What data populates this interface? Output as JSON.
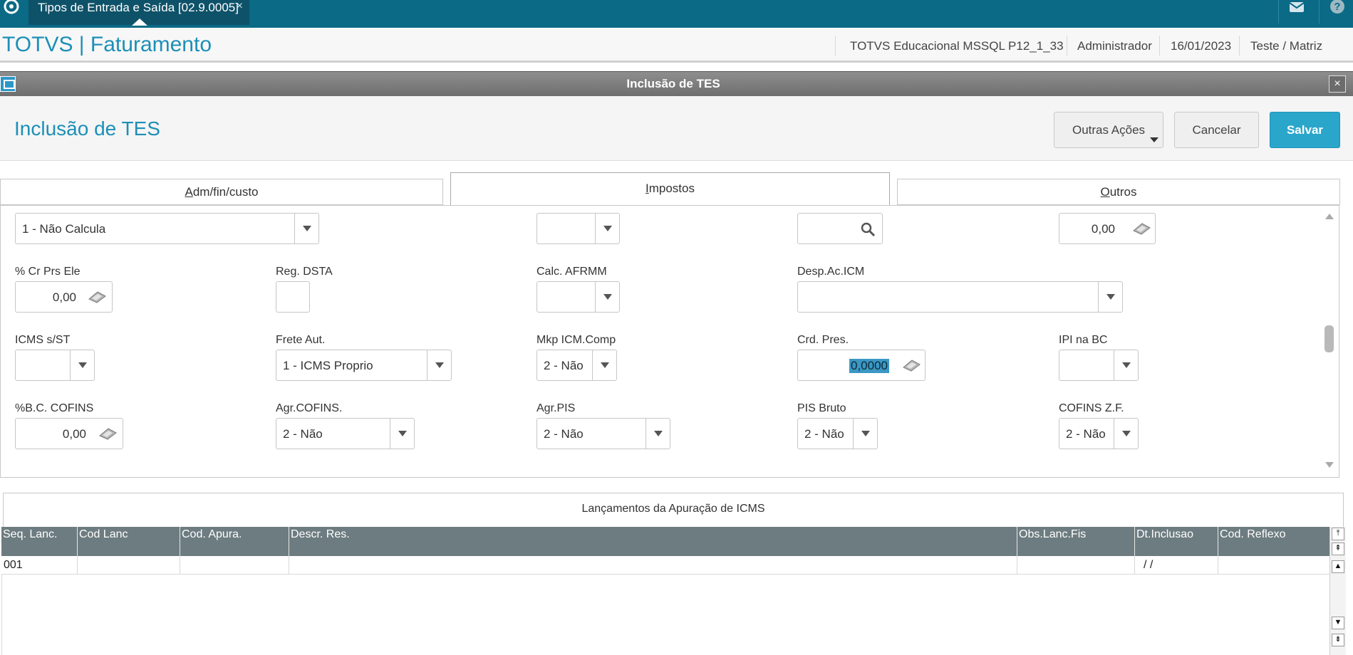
{
  "topbar": {
    "tab_label": "Tipos de Entrada e Saída [02.9.0005]",
    "tab_close": "×"
  },
  "header": {
    "app_title": "TOTVS | Faturamento",
    "environment": "TOTVS Educacional MSSQL P12_1_33",
    "user": "Administrador",
    "date": "16/01/2023",
    "branch": "Teste / Matriz"
  },
  "dialog": {
    "bar_title": "Inclusão de TES",
    "close": "×",
    "form_title": "Inclusão de TES",
    "buttons": {
      "other_actions": "Outras Ações",
      "cancel": "Cancelar",
      "save": "Salvar"
    }
  },
  "tabs": [
    {
      "first": "A",
      "rest": "dm/fin/custo"
    },
    {
      "first": "I",
      "rest": "mpostos"
    },
    {
      "first": "O",
      "rest": "utros"
    }
  ],
  "fields": {
    "row0": {
      "f1_value": "1 - Não Calcula",
      "f2_value": "",
      "f3_value": "",
      "f4_value": "0,00"
    },
    "row1": {
      "cr_prs_ele_label": "% Cr Prs Ele",
      "cr_prs_ele_value": "0,00",
      "reg_dsta_label": "Reg. DSTA",
      "calc_afrmm_label": "Calc. AFRMM",
      "desp_ac_icm_label": "Desp.Ac.ICM"
    },
    "row2": {
      "icms_st_label": "ICMS s/ST",
      "frete_aut_label": "Frete Aut.",
      "frete_aut_value": "1 - ICMS Proprio",
      "mkp_icm_label": "Mkp ICM.Comp",
      "mkp_icm_value": "2 - Não",
      "crd_pres_label": "Crd. Pres.",
      "crd_pres_value": "0,0000",
      "ipi_bc_label": "IPI na BC"
    },
    "row3": {
      "bc_cofins_label": "%B.C. COFINS",
      "bc_cofins_value": "0,00",
      "agr_cofins_label": "Agr.COFINS.",
      "agr_cofins_value": "2 - Não",
      "agr_pis_label": "Agr.PIS",
      "agr_pis_value": "2 - Não",
      "pis_bruto_label": "PIS Bruto",
      "pis_bruto_value": "2 - Não",
      "cofins_zf_label": "COFINS Z.F.",
      "cofins_zf_value": "2 - Não"
    }
  },
  "grid": {
    "title": "Lançamentos da Apuração de ICMS",
    "columns": [
      "Seq. Lanc.",
      "Cod Lanc",
      "Cod. Apura.",
      "Descr. Res.",
      "Obs.Lanc.Fis",
      "Dt.Inclusao",
      "Cod. Reflexo"
    ],
    "rows": [
      [
        "001",
        "",
        "",
        "",
        "",
        "/  /",
        ""
      ]
    ]
  },
  "colors": {
    "topbar": "#0b6a86",
    "brand_text": "#1c8fb7",
    "primary_button": "#2aa6cb",
    "grid_header": "#6d7c80"
  },
  "icons": [
    "totvs-logo-icon",
    "mail-icon",
    "help-icon",
    "window-icon",
    "search-icon",
    "calculator-icon",
    "dropdown-arrow-icon"
  ]
}
